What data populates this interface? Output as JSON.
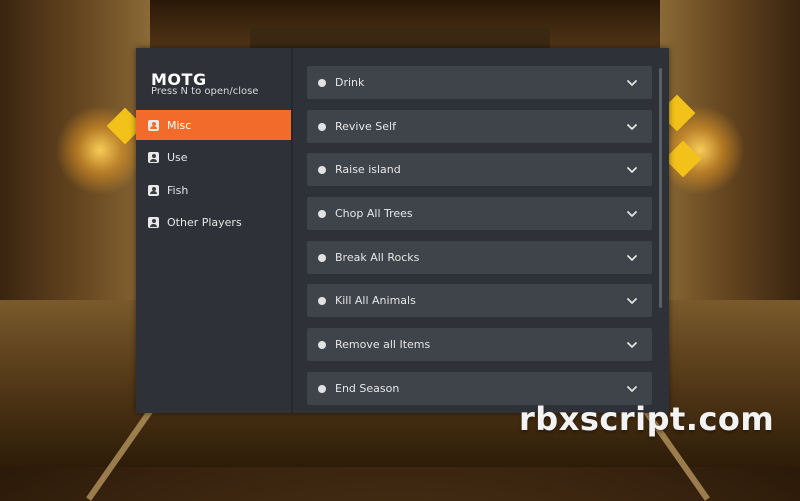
{
  "window": {
    "title": "MOTG",
    "subtitle": "Press N to open/close"
  },
  "sidebar": {
    "items": [
      {
        "label": "Misc",
        "icon": "person-icon",
        "active": true
      },
      {
        "label": "Use",
        "icon": "person-icon",
        "active": false
      },
      {
        "label": "Fish",
        "icon": "person-icon",
        "active": false
      },
      {
        "label": "Other Players",
        "icon": "person-icon",
        "active": false
      }
    ]
  },
  "main": {
    "items": [
      {
        "label": "Drink",
        "icon": "chevron-down-icon"
      },
      {
        "label": "Revive Self",
        "icon": "chevron-down-icon"
      },
      {
        "label": "Raise island",
        "icon": "chevron-down-icon"
      },
      {
        "label": "Chop All Trees",
        "icon": "chevron-down-icon"
      },
      {
        "label": "Break All Rocks",
        "icon": "chevron-down-icon"
      },
      {
        "label": "Kill All Animals",
        "icon": "chevron-down-icon"
      },
      {
        "label": "Remove all Items",
        "icon": "chevron-down-icon"
      },
      {
        "label": "End Season",
        "icon": "chevron-down-icon"
      }
    ]
  },
  "watermark": "rbxscript.com",
  "colors": {
    "accent": "#f26b2a",
    "panel": "#2e3137",
    "item": "#3f434a",
    "text": "#e6e6e6"
  }
}
